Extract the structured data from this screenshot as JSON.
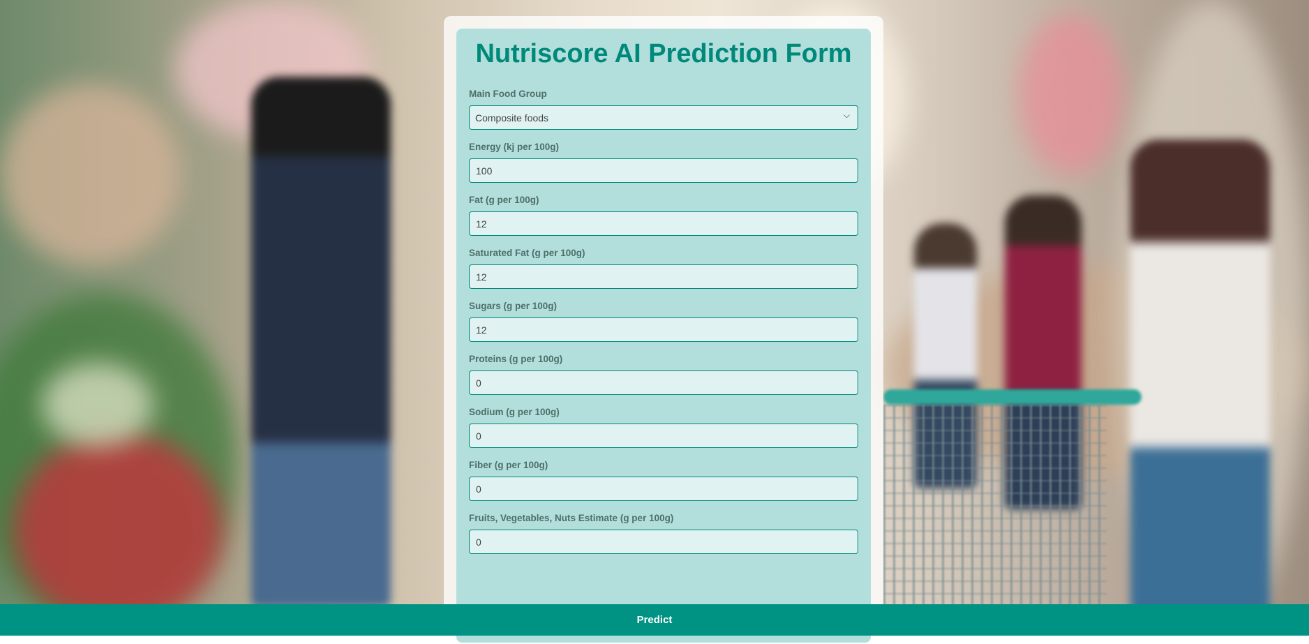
{
  "form": {
    "title": "Nutriscore AI Prediction Form",
    "fields": [
      {
        "label": "Main Food Group",
        "value": "Composite foods",
        "type": "select"
      },
      {
        "label": "Energy (kj per 100g)",
        "value": "100",
        "type": "input"
      },
      {
        "label": "Fat (g per 100g)",
        "value": "12",
        "type": "input"
      },
      {
        "label": "Saturated Fat (g per 100g)",
        "value": "12",
        "type": "input"
      },
      {
        "label": "Sugars (g per 100g)",
        "value": "12",
        "type": "input"
      },
      {
        "label": "Proteins (g per 100g)",
        "value": "0",
        "type": "input"
      },
      {
        "label": "Sodium (g per 100g)",
        "value": "0",
        "type": "input"
      },
      {
        "label": "Fiber (g per 100g)",
        "value": "0",
        "type": "input"
      },
      {
        "label": "Fruits, Vegetables, Nuts Estimate (g per 100g)",
        "value": "0",
        "type": "input"
      }
    ],
    "submit_label": "Predict"
  },
  "colors": {
    "accent": "#00897b",
    "panel": "#b2dfdb",
    "input_bg": "#e0f2f1",
    "button": "#009282"
  },
  "icons": {
    "select_chevron": "chevron-down-icon"
  }
}
